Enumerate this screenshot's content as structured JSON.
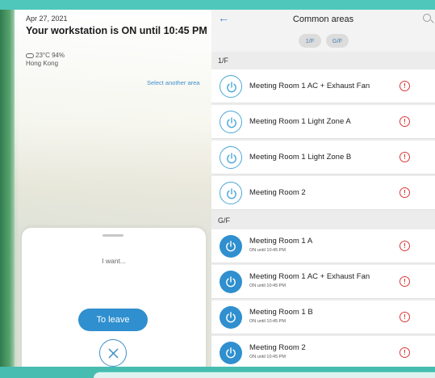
{
  "status": {
    "date": "Apr 27, 2021",
    "headline": "Your workstation is ON until 10:45 PM",
    "weather": "23°C  94%",
    "location": "Hong Kong",
    "select_area_label": "Select another area"
  },
  "sheet": {
    "prompt": "I want...",
    "leave_label": "To leave"
  },
  "areas": {
    "title": "Common areas",
    "floor_filters": [
      "1/F",
      "G/F"
    ],
    "sections": [
      {
        "heading": "1/F",
        "rooms": [
          {
            "name": "Meeting Room 1 AC + Exhaust Fan",
            "state": "off",
            "sub": ""
          },
          {
            "name": "Meeting Room 1 Light Zone A",
            "state": "off",
            "sub": ""
          },
          {
            "name": "Meeting Room 1 Light Zone B",
            "state": "off",
            "sub": ""
          },
          {
            "name": "Meeting Room 2",
            "state": "off",
            "sub": ""
          }
        ]
      },
      {
        "heading": "G/F",
        "rooms": [
          {
            "name": "Meeting Room 1 A",
            "state": "on",
            "sub": "ON until 10:45 PM"
          },
          {
            "name": "Meeting Room 1 AC + Exhaust Fan",
            "state": "on",
            "sub": "ON until 10:45 PM"
          },
          {
            "name": "Meeting Room 1 B",
            "state": "on",
            "sub": "ON until 10:45 PM"
          },
          {
            "name": "Meeting Room 2",
            "state": "on",
            "sub": "ON until 10:45 PM"
          }
        ]
      }
    ],
    "alert_glyph": "!"
  },
  "colors": {
    "accent_blue": "#2f8fcf",
    "alert_red": "#d93838",
    "frame_teal": "#4fc7bb"
  }
}
